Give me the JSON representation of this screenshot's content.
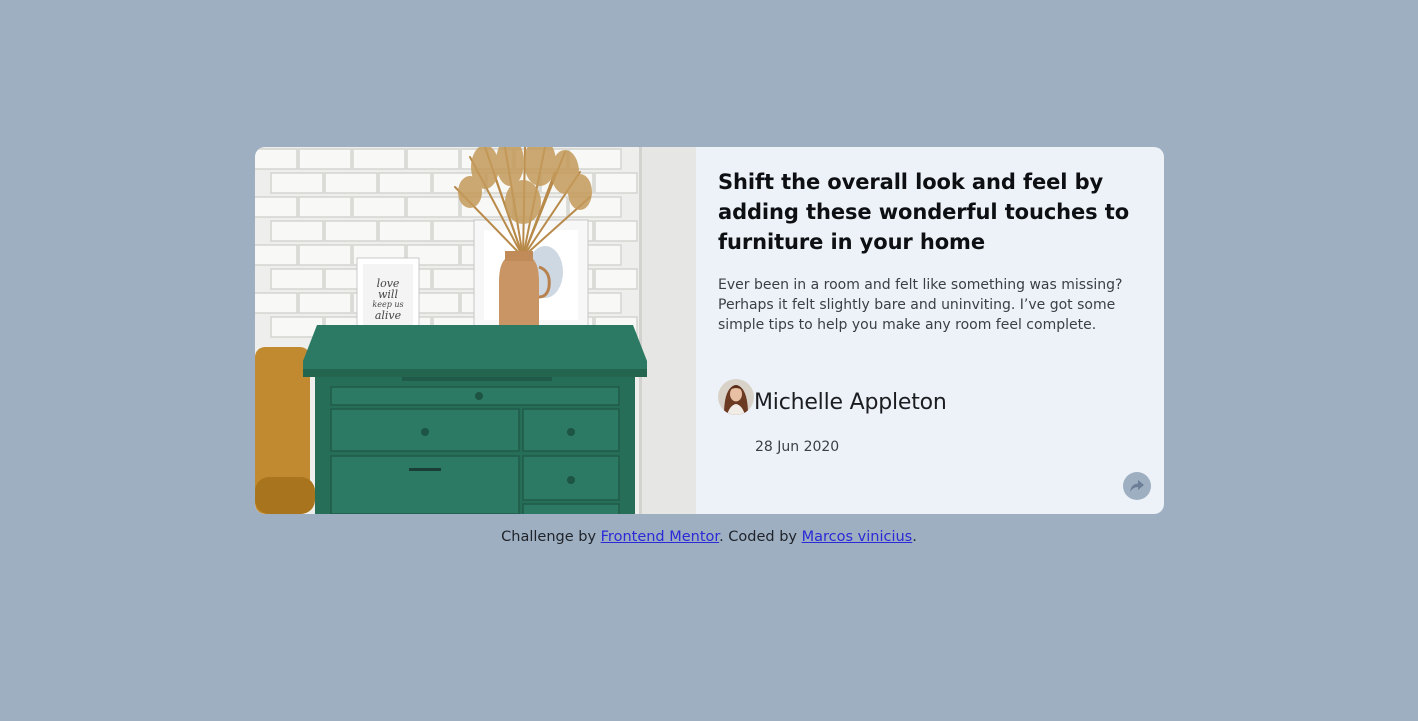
{
  "card": {
    "title": "Shift the overall look and feel by adding these wonderful touches to furniture in your home",
    "description": "Ever been in a room and felt like something was missing? Perhaps it felt slightly bare and uninviting. I’ve got some simple tips to help you make any room feel complete.",
    "author": {
      "name": "Michelle Appleton",
      "date": "28 Jun 2020"
    },
    "share_icon": "share-icon",
    "frame_text": [
      "love",
      "will",
      "keep us",
      "alive"
    ]
  },
  "footer": {
    "prefix": "Challenge by",
    "link1": "Frontend Mentor",
    "middle": ". Coded by",
    "link2": "Marcos vinicius",
    "suffix": "."
  },
  "colors": {
    "page_bg": "#9eafc2",
    "card_bg": "#ecf2f8",
    "dresser": "#2a7560",
    "link": "#2a2ad6"
  }
}
